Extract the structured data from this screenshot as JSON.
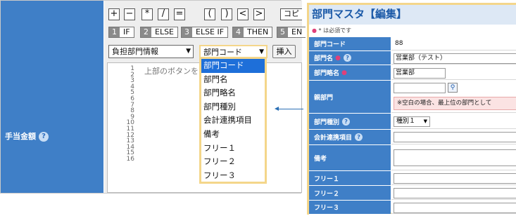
{
  "left_panel": {
    "field_label": "手当金額",
    "operators": [
      "+",
      "−",
      "*",
      "/",
      "=",
      "(",
      ")",
      "<",
      ">",
      "コピ"
    ],
    "keywords": [
      {
        "num": "1",
        "text": "IF"
      },
      {
        "num": "2",
        "text": "ELSE"
      },
      {
        "num": "3",
        "text": "ELSE IF"
      },
      {
        "num": "4",
        "text": "THEN"
      },
      {
        "num": "5",
        "text": "EN"
      }
    ],
    "table_select": "負担部門情報",
    "field_select": "部門コード",
    "insert_button": "挿入",
    "line_numbers": "1\n2\n3\n4\n5\n6\n7\n8\n9\n10\n11\n12\n13\n14\n15\n16",
    "hint_text": "上部のボタンを          してくだ",
    "dropdown_options": [
      "部門コード",
      "部門名",
      "部門略名",
      "部門種別",
      "会計連携項目",
      "備考",
      "フリー１",
      "フリー２",
      "フリー３"
    ]
  },
  "right_panel": {
    "title": "部門マスタ【編集】",
    "required_note": "* は必須です",
    "rows": {
      "code": {
        "label": "部門コード",
        "value": "88"
      },
      "name": {
        "label": "部門名",
        "value": "営業部（テスト）"
      },
      "short": {
        "label": "部門略名",
        "value": "営業部"
      },
      "parent": {
        "label": "親部門",
        "note": "※空白の場合、最上位の部門として"
      },
      "type": {
        "label": "部門種別",
        "value": "種別１"
      },
      "account": {
        "label": "会計連携項目"
      },
      "memo": {
        "label": "備考"
      },
      "free1": {
        "label": "フリー１"
      },
      "free2": {
        "label": "フリー２"
      },
      "free3": {
        "label": "フリー３"
      }
    }
  },
  "colors": {
    "label_blue": "#3f7fc7",
    "highlight_border": "#f4d68a",
    "selected_option": "#1e6fd9",
    "required_star": "#e0407a"
  }
}
